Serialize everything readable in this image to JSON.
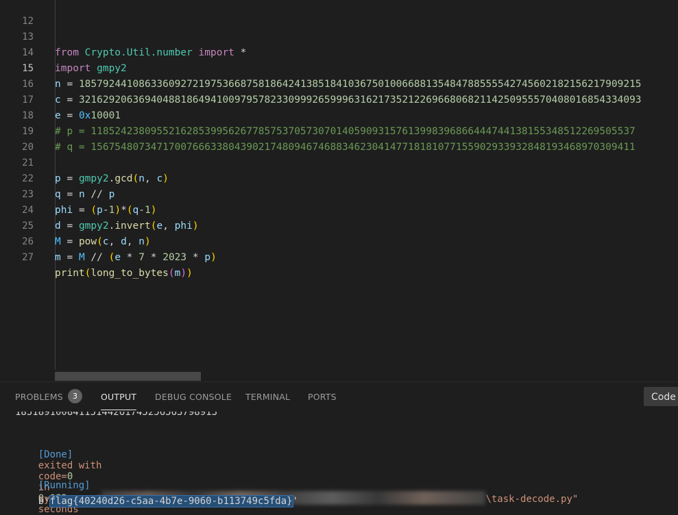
{
  "editor": {
    "line_numbers": [
      "12",
      "13",
      "14",
      "15",
      "16",
      "17",
      "18",
      "19",
      "20",
      "21",
      "22",
      "23",
      "24",
      "25",
      "26",
      "27"
    ],
    "line13": {
      "from": "from",
      "module": "Crypto.Util.number",
      "import": "import",
      "star": "*"
    },
    "line14": {
      "import": "import",
      "module": "gmpy2"
    },
    "line15": {
      "var": "n",
      "eq": "=",
      "value": "1857924410863360927219753668758186424138518410367501006688135484788555542745602182156217909215"
    },
    "line16": {
      "var": "c",
      "eq": "=",
      "value": "3216292063694048818649410097957823309992659996316217352122696680682114250955570408016854334093"
    },
    "line17": {
      "var": "e",
      "eq": "=",
      "hex_prefix": "0x",
      "hex_value": "10001"
    },
    "line18": {
      "comment": "# p = 1185242380955216285399562677857537057307014059093157613998396866444744138155348512269505537"
    },
    "line19": {
      "comment": "# q = 1567548073471700766633804390217480946746883462304147718181077155902933932848193468970309411"
    },
    "line21": {
      "lhs": "p",
      "eq": "=",
      "mod": "gmpy2",
      "fn": "gcd",
      "a1": "n",
      "a2": "c"
    },
    "line22": {
      "lhs": "q",
      "eq": "=",
      "a": "n",
      "op": "//",
      "b": "p"
    },
    "line23": {
      "lhs": "phi",
      "eq": "=",
      "a": "p",
      "b": "q",
      "one": "1"
    },
    "line24": {
      "lhs": "d",
      "eq": "=",
      "mod": "gmpy2",
      "fn": "invert",
      "a1": "e",
      "a2": "phi"
    },
    "line25": {
      "lhs": "M",
      "eq": "=",
      "fn": "pow",
      "a1": "c",
      "a2": "d",
      "a3": "n"
    },
    "line26": {
      "lhs": "m",
      "eq": "=",
      "a": "M",
      "op": "//",
      "e": "e",
      "seven": "7",
      "year": "2023",
      "p": "p"
    },
    "line27": {
      "fn1": "print",
      "fn2": "long_to_bytes",
      "arg": "m"
    }
  },
  "panel": {
    "tabs": [
      "PROBLEMS",
      "OUTPUT",
      "DEBUG CONSOLE",
      "TERMINAL",
      "PORTS"
    ],
    "active_tab": "OUTPUT",
    "problems_count": "3",
    "channel_select": "Code"
  },
  "output": {
    "clipped_number": "18518910084115144261745256563798913",
    "done_tag": "[Done]",
    "done_text_1": "exited with",
    "done_code_kw": "code=",
    "done_code_val": "0",
    "done_in": "in",
    "done_secs": "0.062",
    "done_seconds": "seconds",
    "running_tag": "[Running]",
    "running_cmd": "python -u \"",
    "running_tail": "\\task-decode.py\"",
    "result_prefix": "b'",
    "flag": "flag{40240d26-c5aa-4b7e-9060-b113749c5fda}",
    "result_suffix": "'"
  },
  "colors": {
    "background": "#1e1e1e",
    "keyword": "#c586c0",
    "function": "#dcdcaa",
    "variable": "#9cdcfe",
    "number": "#b5cea8",
    "comment": "#6a9955",
    "selection": "#264f78"
  }
}
